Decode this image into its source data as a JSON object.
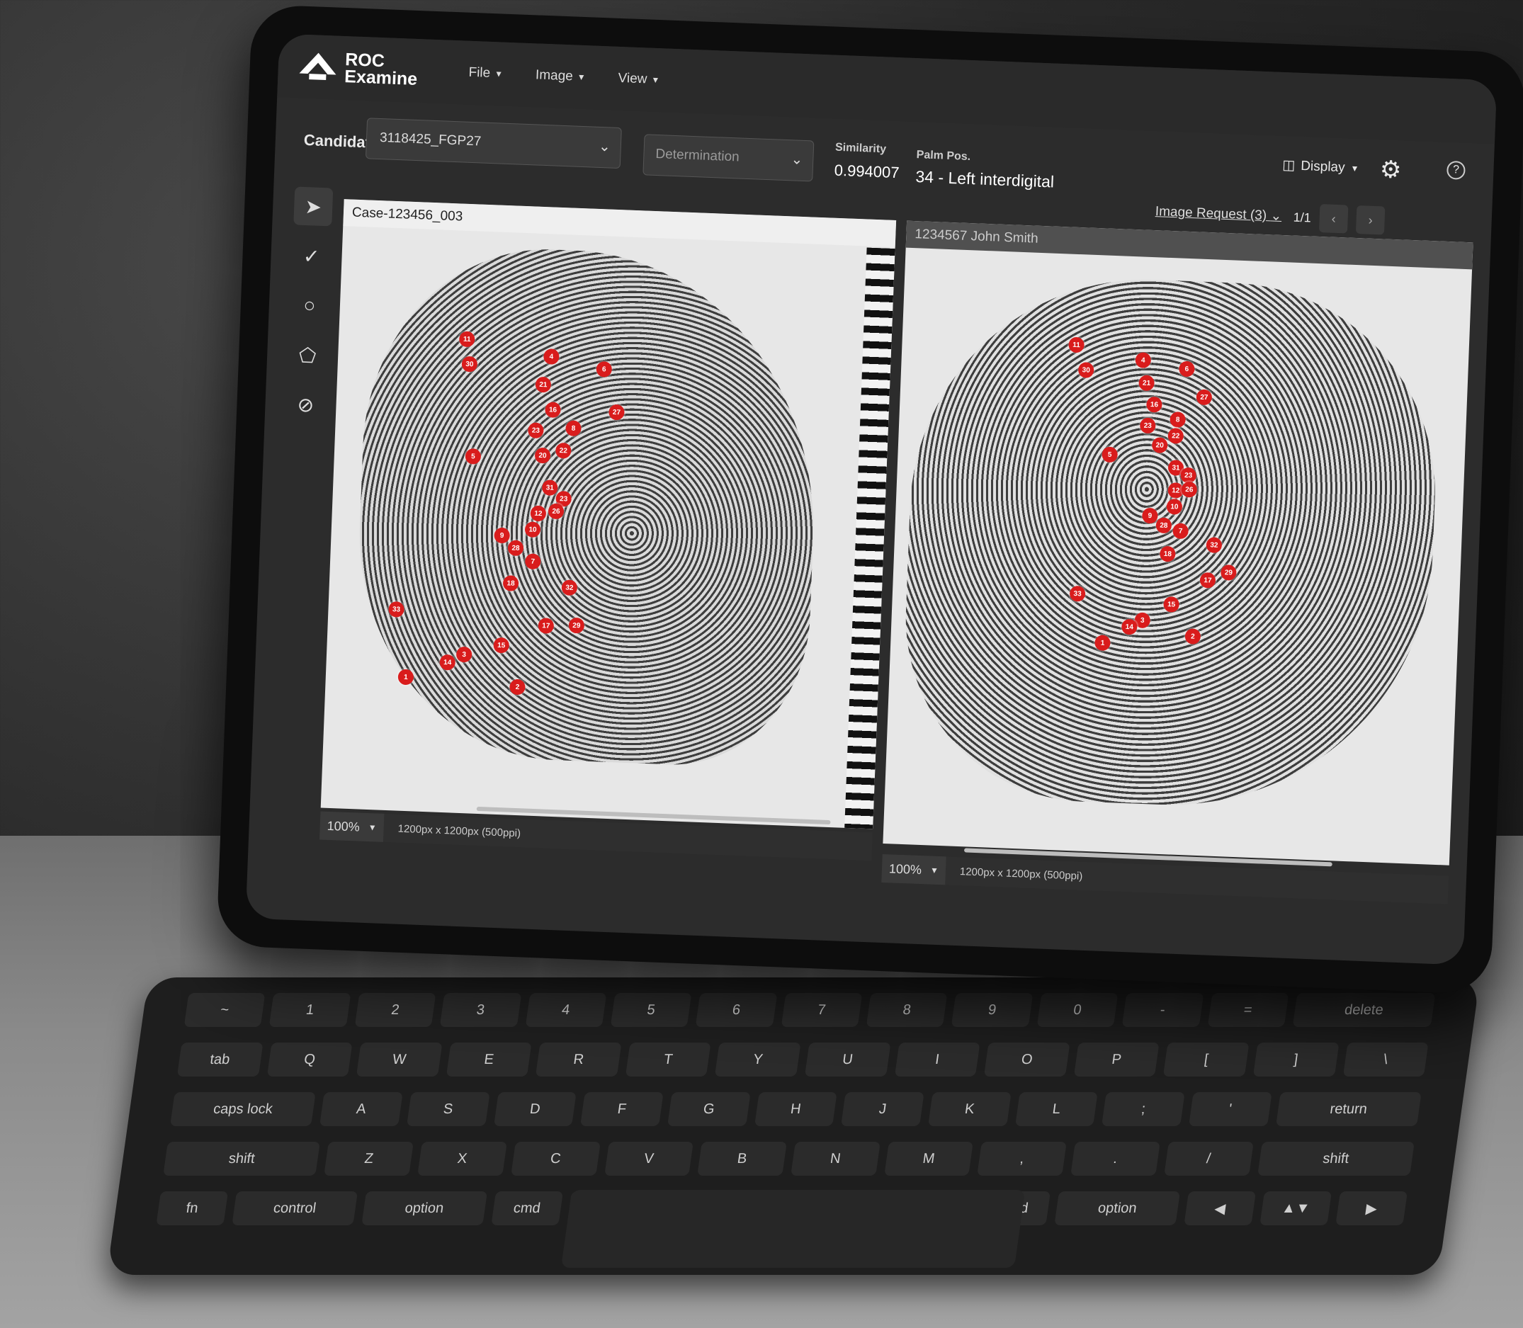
{
  "app": {
    "logo_line1": "ROC",
    "logo_line2": "Examine",
    "menu": [
      {
        "label": "File"
      },
      {
        "label": "Image"
      },
      {
        "label": "View"
      }
    ],
    "display_label": "Display",
    "help_label": "?"
  },
  "candidate": {
    "label": "Candidate",
    "value": "3118425_FGP27",
    "determination_placeholder": "Determination",
    "similarity_label": "Similarity",
    "similarity_value": "0.994007",
    "palm_label": "Palm Pos.",
    "palm_value": "34 - Left interdigital",
    "image_request": "Image Request (3)",
    "pager_text": "1/1"
  },
  "left_pane": {
    "title": "Case-123456_003",
    "zoom": "100%",
    "dimensions": "1200px x 1200px (500ppi)",
    "minutiae": [
      "11",
      "30",
      "4",
      "6",
      "21",
      "16",
      "27",
      "23",
      "8",
      "20",
      "22",
      "5",
      "31",
      "23",
      "12",
      "26",
      "10",
      "9",
      "28",
      "7",
      "18",
      "32",
      "33",
      "17",
      "29",
      "15",
      "3",
      "14",
      "1",
      "2"
    ]
  },
  "right_pane": {
    "title": "1234567 John Smith",
    "zoom": "100%",
    "dimensions": "1200px x 1200px (500ppi)",
    "minutiae": [
      "11",
      "30",
      "4",
      "6",
      "21",
      "27",
      "16",
      "8",
      "23",
      "22",
      "20",
      "5",
      "31",
      "23",
      "12",
      "26",
      "10",
      "9",
      "28",
      "7",
      "32",
      "18",
      "29",
      "17",
      "33",
      "15",
      "3",
      "14",
      "2",
      "1"
    ]
  },
  "keyboard": {
    "row1": [
      "~",
      "1",
      "2",
      "3",
      "4",
      "5",
      "6",
      "7",
      "8",
      "9",
      "0",
      "-",
      "=",
      "delete"
    ],
    "row2": [
      "tab",
      "Q",
      "W",
      "E",
      "R",
      "T",
      "Y",
      "U",
      "I",
      "O",
      "P",
      "[",
      "]",
      "\\"
    ],
    "row3": [
      "caps lock",
      "A",
      "S",
      "D",
      "F",
      "G",
      "H",
      "J",
      "K",
      "L",
      ";",
      "'",
      "return"
    ],
    "row4": [
      "shift",
      "Z",
      "X",
      "C",
      "V",
      "B",
      "N",
      "M",
      ",",
      ".",
      "/",
      "shift"
    ],
    "row5": [
      "fn",
      "control",
      "option",
      "cmd",
      "",
      "cmd",
      "option",
      "◀",
      "▲▼",
      "▶"
    ]
  },
  "colors": {
    "marker": "#d91c1c",
    "ui_dark": "#2c2c2c"
  }
}
